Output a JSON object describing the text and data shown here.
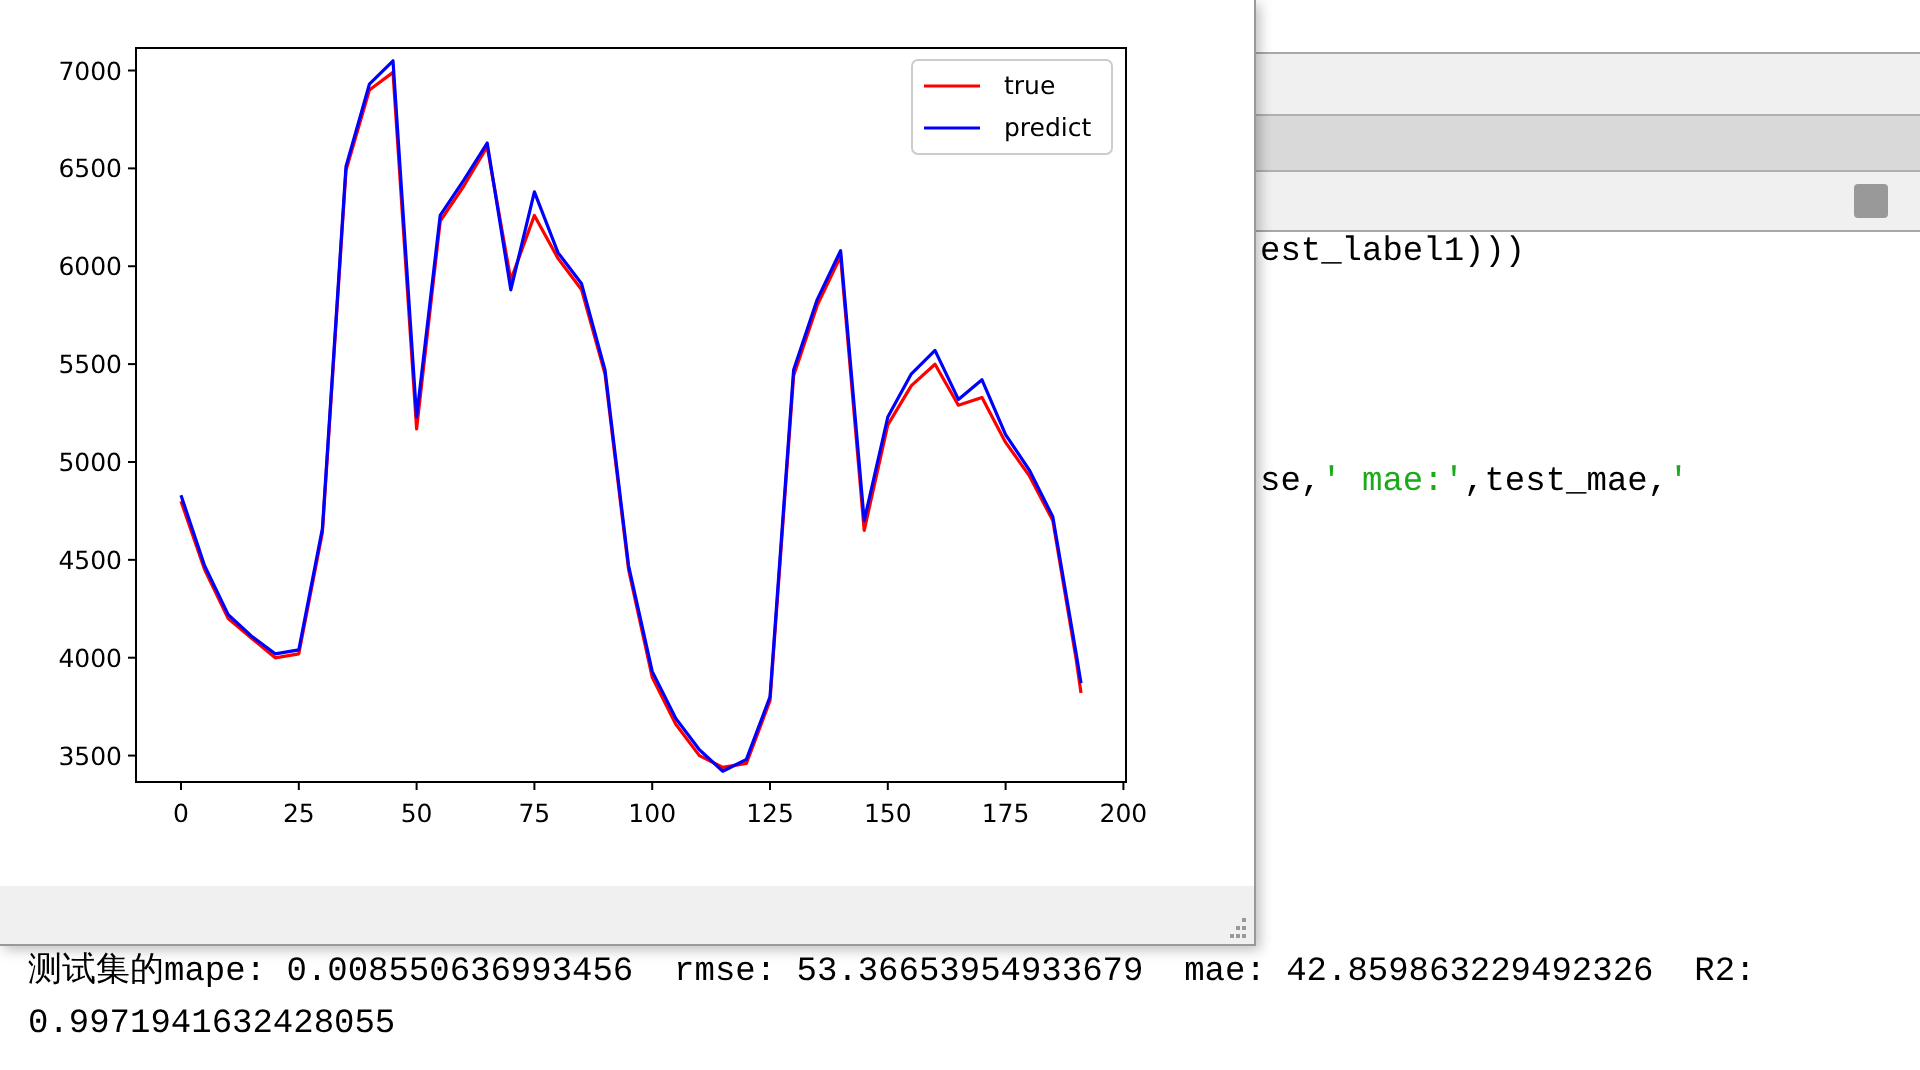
{
  "figure_window": {
    "chart_data": {
      "type": "line",
      "x": [
        0,
        5,
        10,
        15,
        20,
        25,
        30,
        35,
        40,
        45,
        50,
        55,
        60,
        65,
        70,
        75,
        80,
        85,
        90,
        95,
        100,
        105,
        110,
        115,
        120,
        125,
        130,
        135,
        140,
        145,
        150,
        155,
        160,
        165,
        170,
        175,
        180,
        185,
        190,
        191
      ],
      "series": [
        {
          "name": "true",
          "color": "#ff0000",
          "values": [
            4800,
            4450,
            4200,
            4100,
            4000,
            4020,
            4640,
            6490,
            6900,
            6990,
            5170,
            6230,
            6410,
            6610,
            5930,
            6260,
            6040,
            5880,
            5450,
            4450,
            3900,
            3660,
            3500,
            3440,
            3460,
            3780,
            5440,
            5800,
            6050,
            4650,
            5190,
            5390,
            5500,
            5290,
            5330,
            5100,
            4930,
            4700,
            3990,
            3820
          ]
        },
        {
          "name": "predict",
          "color": "#0000ff",
          "values": [
            4830,
            4470,
            4220,
            4110,
            4020,
            4040,
            4660,
            6510,
            6930,
            7050,
            5230,
            6260,
            6440,
            6630,
            5880,
            6380,
            6070,
            5910,
            5470,
            4470,
            3930,
            3690,
            3530,
            3420,
            3480,
            3800,
            5470,
            5830,
            6080,
            4700,
            5230,
            5450,
            5570,
            5320,
            5420,
            5140,
            4960,
            4720,
            4020,
            3870
          ]
        }
      ],
      "xlim": [
        -9.55,
        200.55
      ],
      "ylim": [
        3365,
        7115
      ],
      "xticks": [
        0,
        25,
        50,
        75,
        100,
        125,
        150,
        175,
        200
      ],
      "yticks": [
        3500,
        4000,
        4500,
        5000,
        5500,
        6000,
        6500,
        7000
      ],
      "legend": true
    }
  },
  "editor": {
    "code_lines": [
      [
        {
          "text": "est_label1)))",
          "kind": "code"
        }
      ],
      [
        {
          "text": "se,",
          "kind": "code"
        },
        {
          "text": "' mae:'",
          "kind": "string"
        },
        {
          "text": ",test_mae,",
          "kind": "code"
        },
        {
          "text": "'",
          "kind": "string"
        }
      ]
    ]
  },
  "output": [
    "测试集的mape: 0.008550636993456  rmse: 53.36653954933679  mae: 42.859863229492326  R2:",
    "0.9971941632428055"
  ]
}
